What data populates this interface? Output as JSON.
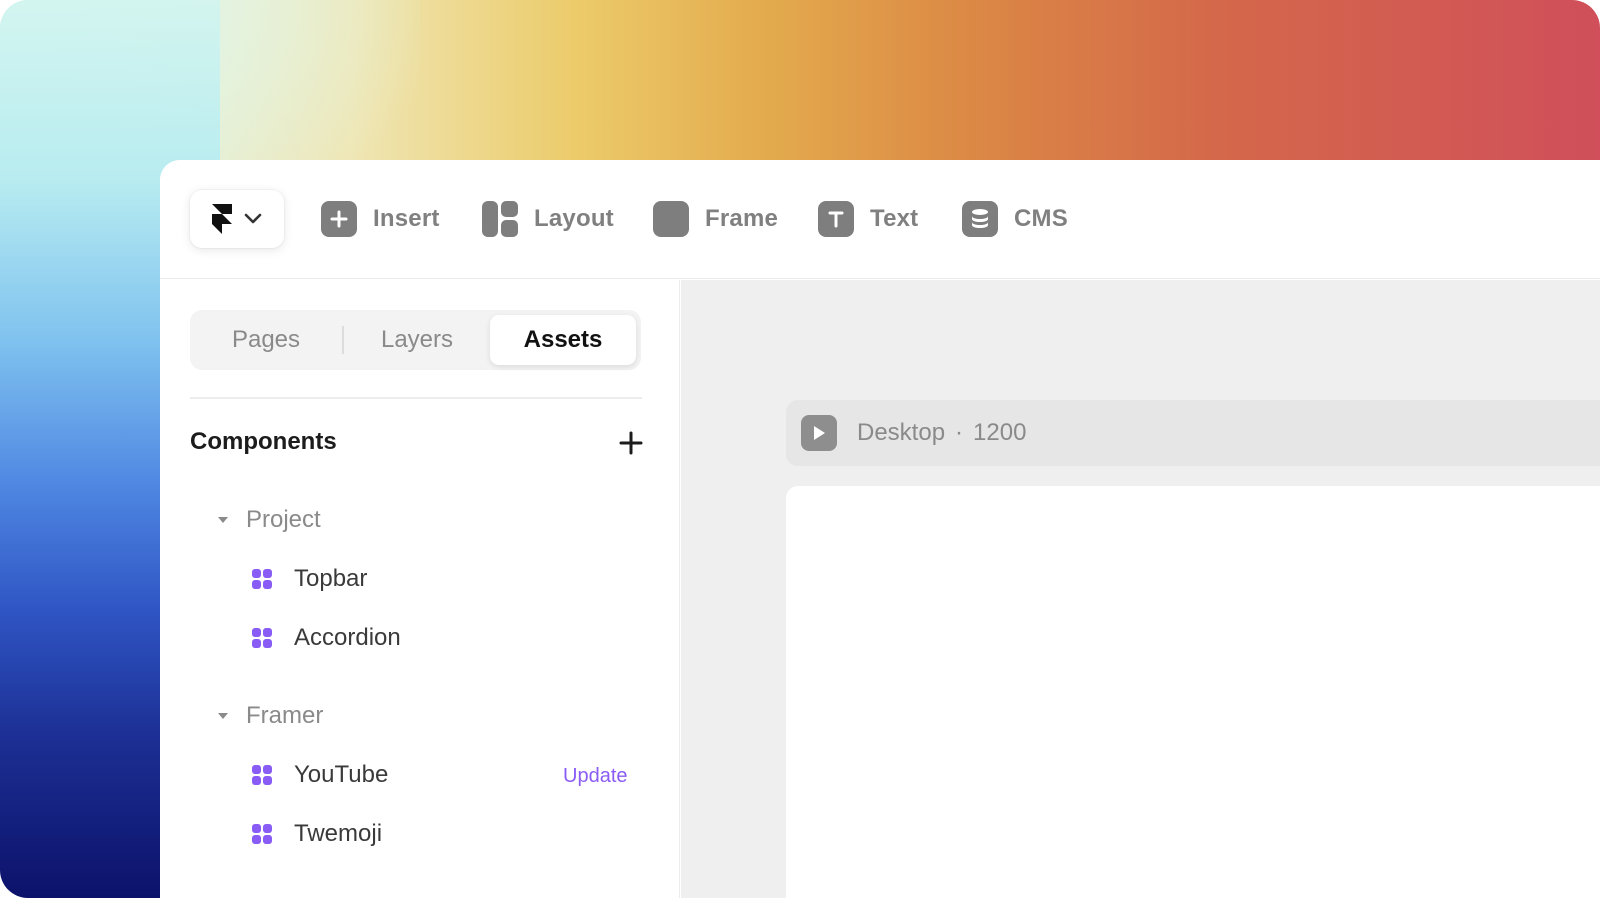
{
  "toolbar": {
    "tools": [
      {
        "label": "Insert",
        "icon": "plus-square-icon"
      },
      {
        "label": "Layout",
        "icon": "layout-icon"
      },
      {
        "label": "Frame",
        "icon": "frame-icon"
      },
      {
        "label": "Text",
        "icon": "text-icon"
      },
      {
        "label": "CMS",
        "icon": "database-icon"
      }
    ]
  },
  "sidebar": {
    "tabs": [
      "Pages",
      "Layers",
      "Assets"
    ],
    "active_tab": "Assets",
    "section_title": "Components",
    "groups": [
      {
        "name": "Project",
        "items": [
          "Topbar",
          "Accordion"
        ]
      },
      {
        "name": "Framer",
        "items": [
          "YouTube",
          "Twemoji"
        ]
      }
    ],
    "update_label": "Update"
  },
  "canvas": {
    "frame_name": "Desktop",
    "separator": "·",
    "frame_width": "1200"
  },
  "colors": {
    "accent": "#8b5cf6",
    "icon_gray": "#7e7e7e"
  }
}
